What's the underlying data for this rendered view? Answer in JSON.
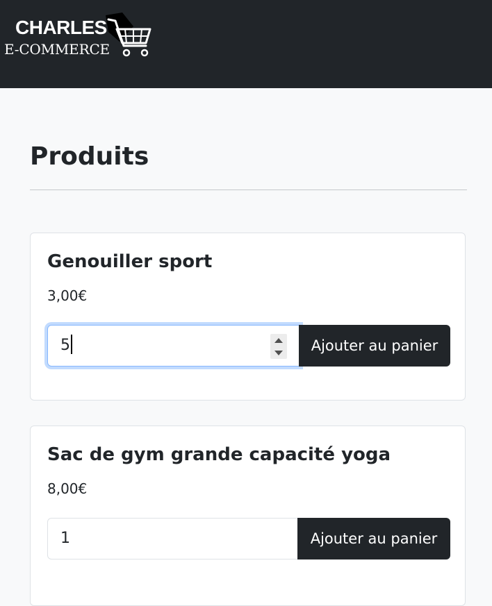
{
  "header": {
    "logo_top": "CHARLES",
    "logo_bottom": "E-COMMERCE",
    "logo_icon": "shopping-cart-icon",
    "background": "#212529"
  },
  "main": {
    "title": "Produits",
    "products": [
      {
        "name": "Genouiller sport",
        "price": "3,00€",
        "quantity": "5",
        "button_label": "Ajouter au panier"
      },
      {
        "name": "Sac de gym grande capacité yoga",
        "price": "8,00€",
        "quantity": "1",
        "button_label": "Ajouter au panier"
      }
    ]
  },
  "colors": {
    "page_background": "#f8f9fa",
    "button": "#212529",
    "focus_ring": "#86b7fe"
  }
}
